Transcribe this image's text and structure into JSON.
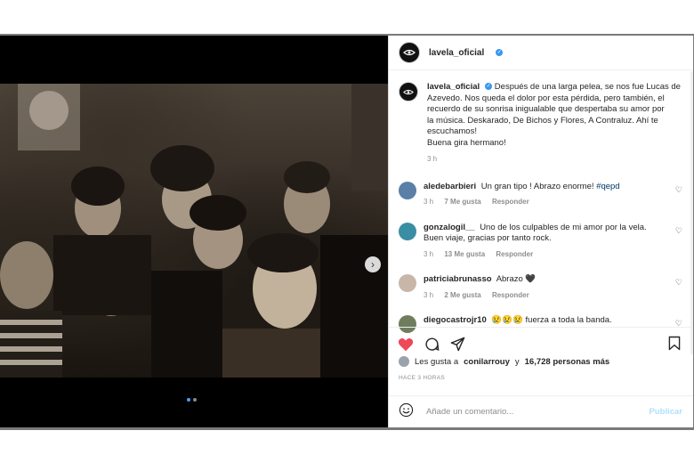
{
  "post": {
    "username": "lavela_oficial",
    "caption": {
      "username": "lavela_oficial",
      "line1": "Después de una larga pelea, se nos fue Lucas de",
      "line2": "Azevedo. Nos queda el dolor por esta pérdida, pero también, el",
      "line3": "recuerdo de su sonrisa inigualable que despertaba su amor por",
      "line4": "la música. Deskarado, De Bichos y Flores, A Contraluz. Ahí te",
      "line5": "escuchamos!",
      "line6": "Buena gira hermano!",
      "time": "3 h"
    },
    "comments": [
      {
        "user": "aledebarbieri",
        "text": "Un gran tipo ! Abrazo enorme! ",
        "hashtag": "#qepd",
        "time": "3 h",
        "likes": "7 Me gusta",
        "reply": "Responder",
        "avatar_color": "#5b7fa6"
      },
      {
        "user": "gonzalogil__",
        "text": "Uno de los culpables de mi amor por la vela.",
        "text2": "Buen viaje, gracias por tanto rock.",
        "time": "3 h",
        "likes": "13 Me gusta",
        "reply": "Responder",
        "avatar_color": "#3a8ea3"
      },
      {
        "user": "patriciabrunasso",
        "text": "Abrazo 🖤",
        "time": "3 h",
        "likes": "2 Me gusta",
        "reply": "Responder",
        "avatar_color": "#c8b7a8"
      },
      {
        "user": "diegocastrojr10",
        "text": "😢😢😢 fuerza a toda la banda.",
        "avatar_color": "#6f7d5e"
      }
    ],
    "likes_prefix": "Les gusta a",
    "likes_user": "conilarrouy",
    "likes_and": "y",
    "likes_count": "16,728 personas más",
    "time_ago": "HACE 3 HORAS",
    "comment_placeholder": "Añade un comentario...",
    "publish": "Publicar"
  },
  "colors": {
    "accent_blue": "#3897f0",
    "like_red": "#ed4956",
    "publish_disabled": "#b2dffc"
  },
  "icons": {
    "heart": "heart-icon",
    "comment": "comment-icon",
    "share": "share-icon",
    "save": "bookmark-icon",
    "emoji": "emoji-icon",
    "next": "chevron-right-icon"
  },
  "carousel": {
    "current": 1,
    "total": 2
  }
}
